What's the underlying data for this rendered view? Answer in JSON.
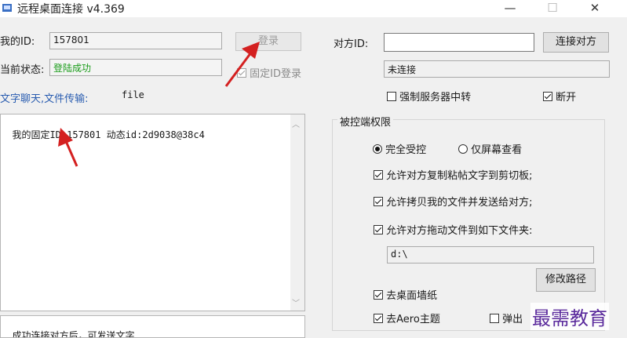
{
  "window": {
    "title": "远程桌面连接 v4.369",
    "minimize": "—",
    "maximize": "☐",
    "close": "✕"
  },
  "left": {
    "my_id_label": "我的ID:",
    "my_id_value": "157801",
    "login_button": "登录",
    "status_label": "当前状态:",
    "status_value": "登陆成功",
    "fixed_id_login": "固定ID登录",
    "chat_link": "文字聊天,文件传输:",
    "file_label": "file",
    "log_text": "我的固定ID:157801 动态id:2d9038@38c4",
    "message_placeholder": "成功连接对方后，可发送文字..."
  },
  "right": {
    "peer_id_label": "对方ID:",
    "peer_id_value": "",
    "connect_button": "连接对方",
    "conn_status": "未连接",
    "force_relay": "强制服务器中转",
    "disconnect": "断开",
    "group_title": "被控端权限",
    "full_control": "完全受控",
    "screen_only": "仅屏幕查看",
    "allow_copy_paste": "允许对方复制粘帖文字到剪切板;",
    "allow_send_files": "允许拷贝我的文件并发送给对方;",
    "allow_drag_files": "允许对方拖动文件到如下文件夹:",
    "folder_path": "d:\\",
    "change_path_button": "修改路径",
    "remove_wallpaper": "去桌面墙纸",
    "remove_aero": "去Aero主题",
    "popup_label": "弹出"
  },
  "watermark": "最需教育",
  "colors": {
    "status_green": "#1a9c1a",
    "link_blue": "#2a5db0",
    "arrow_red": "#d42020",
    "watermark_purple": "#5a2a9c"
  }
}
